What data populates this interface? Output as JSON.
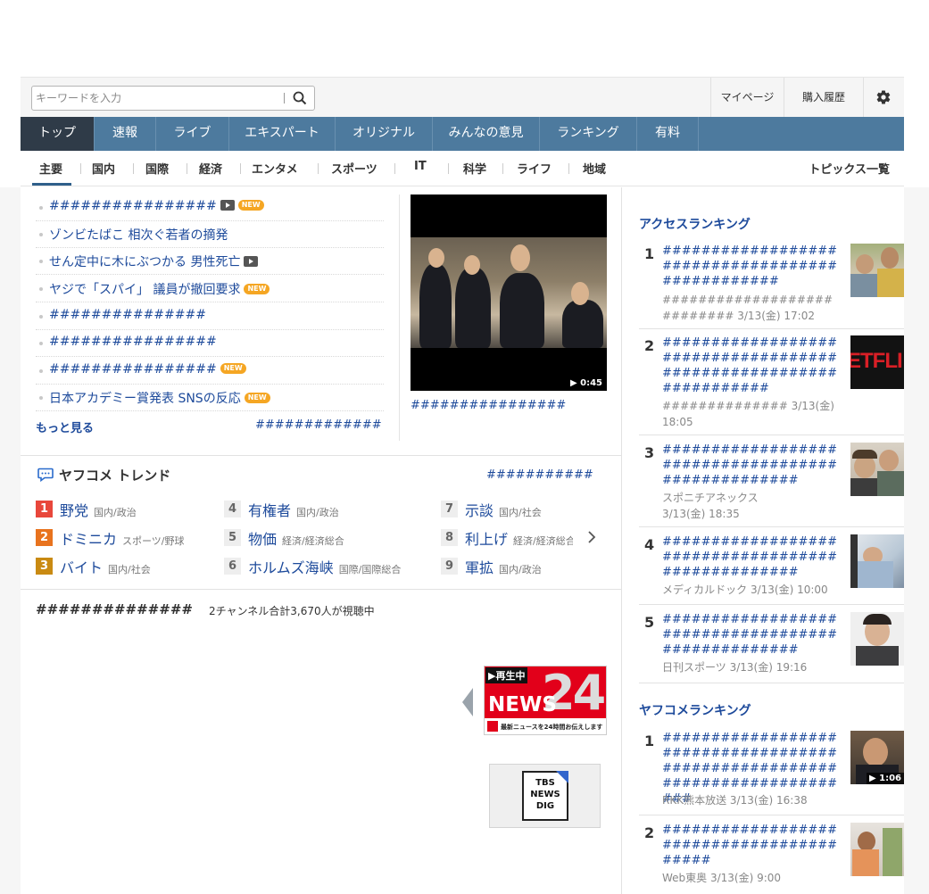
{
  "header": {
    "search_placeholder": "キーワードを入力",
    "mypage": "マイページ",
    "purchase_history": "購入履歴"
  },
  "nav": {
    "tabs": [
      "トップ",
      "速報",
      "ライブ",
      "エキスパート",
      "オリジナル",
      "みんなの意見",
      "ランキング",
      "有料"
    ]
  },
  "subnav": {
    "items": [
      "主要",
      "国内",
      "国際",
      "経済",
      "エンタメ",
      "スポーツ",
      "IT",
      "科学",
      "ライフ",
      "地域"
    ],
    "topics_all": "トピックス一覧"
  },
  "topics": {
    "items": [
      {
        "text": "################",
        "video": true,
        "new": true
      },
      {
        "text": "ゾンビたばこ 相次ぐ若者の摘発",
        "video": false,
        "new": false
      },
      {
        "text": "せん定中に木にぶつかる 男性死亡",
        "video": true,
        "new": false
      },
      {
        "text": "ヤジで「スパイ」 議員が撤回要求",
        "video": false,
        "new": true
      },
      {
        "text": "###############",
        "video": false,
        "new": false
      },
      {
        "text": "################",
        "video": false,
        "new": false
      },
      {
        "text": "################",
        "video": false,
        "new": true
      },
      {
        "text": "日本アカデミー賞発表 SNSの反応",
        "video": false,
        "new": true
      }
    ],
    "new_label": "NEW",
    "more": "もっと見る",
    "more_right": "#############",
    "video_duration": "▶ 0:45",
    "video_caption": "################"
  },
  "trend": {
    "title": "ヤフコメ トレンド",
    "more": "###########",
    "items": [
      {
        "rank": "1",
        "word": "野党",
        "cat": "国内/政治"
      },
      {
        "rank": "2",
        "word": "ドミニカ",
        "cat": "スポーツ/野球"
      },
      {
        "rank": "3",
        "word": "バイト",
        "cat": "国内/社会"
      },
      {
        "rank": "4",
        "word": "有権者",
        "cat": "国内/政治"
      },
      {
        "rank": "5",
        "word": "物価",
        "cat": "経済/経済総合"
      },
      {
        "rank": "6",
        "word": "ホルムズ海峡",
        "cat": "国際/国際総合"
      },
      {
        "rank": "7",
        "word": "示談",
        "cat": "国内/社会"
      },
      {
        "rank": "8",
        "word": "利上げ",
        "cat": "経済/経済総合"
      },
      {
        "rank": "9",
        "word": "軍拡",
        "cat": "国内/政治"
      }
    ]
  },
  "live": {
    "title": "##############",
    "count": "2チャンネル合計3,670人が視聴中",
    "news24_live": "▶再生中",
    "news24_word": "NEWS",
    "news24_num": "24",
    "news24_sub": "最新ニュースを24時間お伝えします",
    "tbs_lines": [
      "TBS",
      "NEWS",
      "DIG"
    ]
  },
  "access_ranking": {
    "title": "アクセスランキング",
    "items": [
      {
        "rank": "1",
        "headline": "################################################",
        "meta": "###########################",
        "date": " 3/13(金) 17:02"
      },
      {
        "rank": "2",
        "headline": "#################################################################",
        "meta": "##############",
        "date": " 3/13(金) 18:05"
      },
      {
        "rank": "3",
        "headline": "##################################################",
        "meta": "スポニチアネックス",
        "date": " 3/13(金) 18:35"
      },
      {
        "rank": "4",
        "headline": "##################################################",
        "meta": "メディカルドック",
        "date": " 3/13(金) 10:00"
      },
      {
        "rank": "5",
        "headline": "##################################################",
        "meta": "日刊スポーツ",
        "date": " 3/13(金) 19:16"
      }
    ]
  },
  "yafucome_ranking": {
    "title": "ヤフコメランキング",
    "items": [
      {
        "rank": "1",
        "headline": "###########################################################################",
        "meta": "RKK熊本放送",
        "date": " 3/13(金) 16:38",
        "duration": "▶ 1:06"
      },
      {
        "rank": "2",
        "headline": "#########################################",
        "meta": "Web東奥",
        "date": " 3/13(金) 9:00"
      }
    ]
  },
  "thumb_text": {
    "netflix": "ETFLI"
  }
}
